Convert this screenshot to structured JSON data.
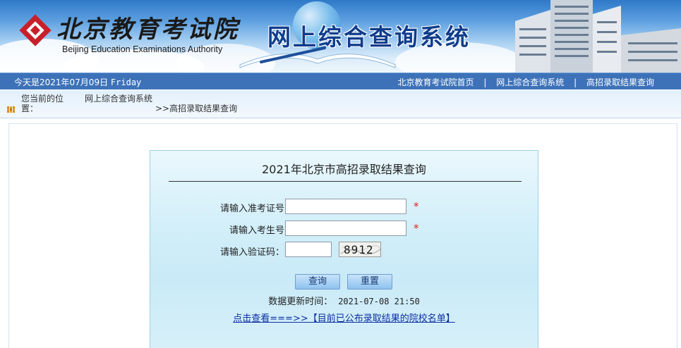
{
  "header": {
    "org_name_cn": "北京教育考试院",
    "org_name_en": "Beijing Education Examinations Authority",
    "system_title": "网上综合查询系统"
  },
  "navbar": {
    "today_prefix": "今天是2021年07月09日",
    "weekday": "Friday",
    "links": [
      {
        "label": "北京教育考试院首页"
      },
      {
        "label": "网上综合查询系统"
      },
      {
        "label": "高招录取结果查询"
      }
    ],
    "separator": "|"
  },
  "breadcrumb": {
    "label": "您当前的位置：",
    "items": [
      "网上综合查询系统",
      ">>高招录取结果查询"
    ]
  },
  "panel": {
    "title": "2021年北京市高招录取结果查询",
    "fields": [
      {
        "label": "请输入准考证号",
        "value": "",
        "required": true
      },
      {
        "label": "请输入考生号",
        "value": "",
        "required": true
      },
      {
        "label": "请输入验证码：",
        "value": ""
      }
    ],
    "required_mark": "*",
    "captcha_text": "8912",
    "buttons": {
      "query": "查询",
      "reset": "重置"
    },
    "update_label": "数据更新时间：",
    "update_time": "2021-07-08 21:50",
    "list_link": "点击查看===>>【目前已公布录取结果的院校名单】"
  },
  "colors": {
    "navbar_bg": "#3d72b8",
    "title_blue": "#0f3d8c",
    "link_blue": "#0b2fa3",
    "required_red": "#e02020",
    "logo_red": "#c8202b"
  }
}
